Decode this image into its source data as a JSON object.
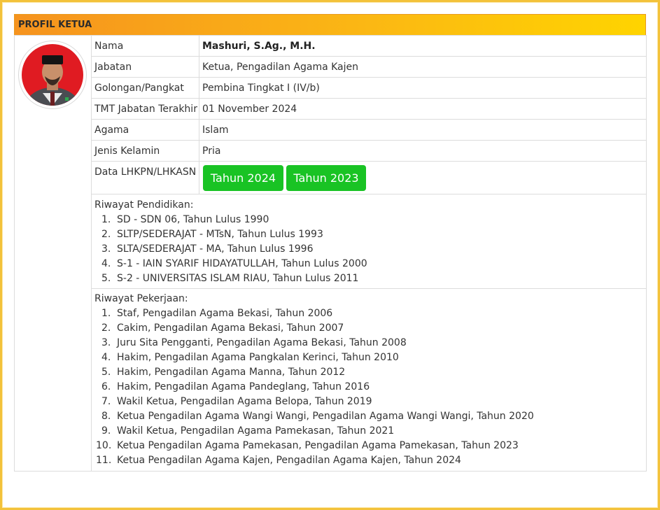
{
  "header": {
    "title": "PROFIL KETUA"
  },
  "profile": {
    "rows": [
      {
        "label": "Nama",
        "value": "Mashuri, S.Ag., M.H."
      },
      {
        "label": "Jabatan",
        "value": "Ketua, Pengadilan Agama Kajen"
      },
      {
        "label": "Golongan/Pangkat",
        "value": "Pembina Tingkat I (IV/b)"
      },
      {
        "label": "TMT Jabatan Terakhir",
        "value": "01 November 2024"
      },
      {
        "label": "Agama",
        "value": "Islam"
      },
      {
        "label": "Jenis Kelamin",
        "value": "Pria"
      }
    ],
    "lhkpn": {
      "label": "Data LHKPN/LHKASN",
      "buttons": [
        "Tahun 2024",
        "Tahun 2023"
      ]
    }
  },
  "pendidikan": {
    "title": "Riwayat Pendidikan:",
    "items": [
      "SD - SDN 06, Tahun Lulus 1990",
      "SLTP/SEDERAJAT - MTsN, Tahun Lulus 1993",
      "SLTA/SEDERAJAT - MA, Tahun Lulus 1996",
      "S-1 - IAIN SYARIF HIDAYATULLAH, Tahun Lulus 2000",
      "S-2 - UNIVERSITAS ISLAM RIAU, Tahun Lulus 2011"
    ]
  },
  "pekerjaan": {
    "title": "Riwayat Pekerjaan:",
    "items": [
      "Staf, Pengadilan Agama Bekasi, Tahun 2006",
      "Cakim, Pengadilan Agama Bekasi, Tahun 2007",
      "Juru Sita Pengganti, Pengadilan Agama Bekasi, Tahun 2008",
      "Hakim, Pengadilan Agama Pangkalan Kerinci, Tahun 2010",
      "Hakim, Pengadilan Agama Manna, Tahun 2012",
      "Hakim, Pengadilan Agama Pandeglang, Tahun 2016",
      "Wakil Ketua, Pengadilan Agama Belopa, Tahun 2019",
      "Ketua Pengadilan Agama Wangi Wangi, Pengadilan Agama Wangi Wangi, Tahun 2020",
      "Wakil Ketua, Pengadilan Agama Pamekasan, Tahun 2021",
      "Ketua Pengadilan Agama Pamekasan, Pengadilan Agama Pamekasan, Tahun 2023",
      "Ketua Pengadilan Agama Kajen, Pengadilan Agama Kajen, Tahun 2024"
    ]
  },
  "colors": {
    "header_start": "#f6931e",
    "header_end": "#ffd400",
    "button_green": "#19c324",
    "frame_border": "#f3c23a"
  }
}
